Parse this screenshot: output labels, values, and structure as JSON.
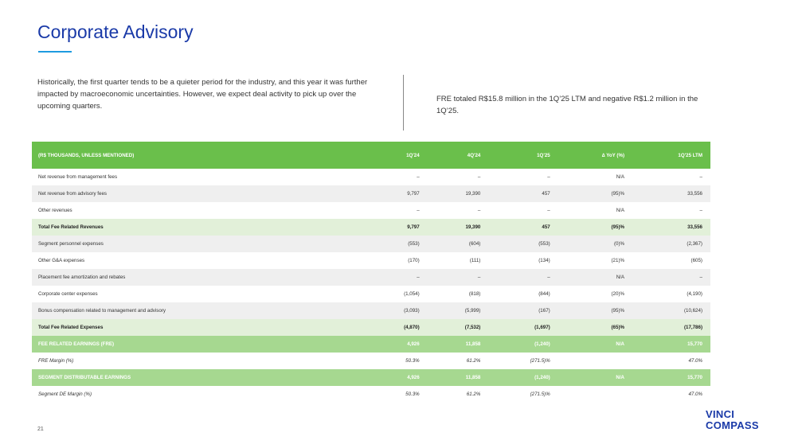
{
  "title": "Corporate Advisory",
  "intro_left": "Historically, the first quarter tends to be a quieter period for the industry, and this year it was further impacted by macroeconomic uncertainties. However, we expect deal activity to pick up over the upcoming quarters.",
  "intro_right": "FRE totaled R$15.8 million in the 1Q’25 LTM and negative R$1.2 million in the 1Q’25.",
  "table": {
    "headers": [
      "(R$ THOUSANDS, UNLESS MENTIONED)",
      "1Q'24",
      "4Q'24",
      "1Q'25",
      "∆ YoY (%)",
      "1Q'25 LTM"
    ],
    "rows": [
      [
        "Net revenue from management fees",
        "–",
        "–",
        "–",
        "N/A",
        "–"
      ],
      [
        "Net revenue from advisory fees",
        "9,797",
        "19,390",
        "457",
        "(95)%",
        "33,556"
      ],
      [
        "Other revenues",
        "–",
        "–",
        "–",
        "N/A",
        "–"
      ],
      [
        "Total Fee Related Revenues",
        "9,797",
        "19,390",
        "457",
        "(95)%",
        "33,556"
      ],
      [
        "Segment personnel expenses",
        "(553)",
        "(604)",
        "(553)",
        "(0)%",
        "(2,367)"
      ],
      [
        "Other G&A expenses",
        "(170)",
        "(111)",
        "(134)",
        "(21)%",
        "(605)"
      ],
      [
        "Placement fee amortization and rebates",
        "–",
        "–",
        "–",
        "N/A",
        "–"
      ],
      [
        "Corporate center expenses",
        "(1,054)",
        "(818)",
        "(844)",
        "(20)%",
        "(4,190)"
      ],
      [
        "Bonus compensation related to management and advisory",
        "(3,093)",
        "(5,999)",
        "(167)",
        "(95)%",
        "(10,624)"
      ],
      [
        "Total Fee Related Expenses",
        "(4,870)",
        "(7,532)",
        "(1,697)",
        "(65)%",
        "(17,786)"
      ],
      [
        "FEE RELATED EARNINGS (FRE)",
        "4,926",
        "11,858",
        "(1,240)",
        "N/A",
        "15,770"
      ],
      [
        "FRE Margin (%)",
        "50.3%",
        "61.2%",
        "(271.5)%",
        "",
        "47.0%"
      ],
      [
        "SEGMENT DISTRIBUTABLE EARNINGS",
        "4,926",
        "11,858",
        "(1,240)",
        "N/A",
        "15,770"
      ],
      [
        "Segment DE Margin (%)",
        "50.3%",
        "61.2%",
        "(271.5)%",
        "",
        "47.0%"
      ]
    ]
  },
  "page_number": "21",
  "logo": [
    "VINCI",
    "COMPASS"
  ]
}
